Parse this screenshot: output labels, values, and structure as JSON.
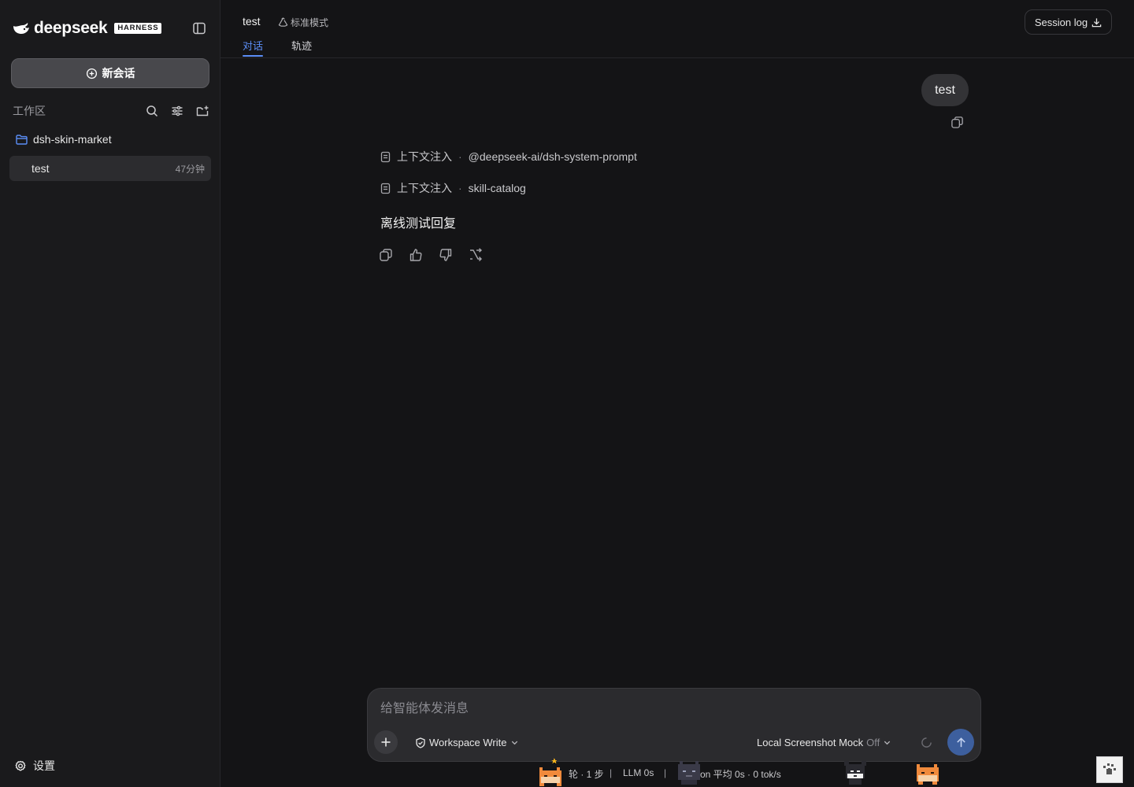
{
  "brand": {
    "name": "deepseek",
    "badge": "HARNESS"
  },
  "sidebar": {
    "new_chat_label": "新会话",
    "workspace_label": "工作区",
    "tools": [
      "search-icon",
      "filter-icon",
      "new-folder-icon"
    ],
    "folder": {
      "name": "dsh-skin-market"
    },
    "sessions": [
      {
        "title": "test",
        "time": "47分钟"
      }
    ],
    "settings_label": "设置"
  },
  "header": {
    "title": "test",
    "mode": "标准模式",
    "tabs": [
      {
        "label": "对话",
        "active": true
      },
      {
        "label": "轨迹",
        "active": false
      }
    ],
    "session_log_label": "Session log"
  },
  "conversation": {
    "user_message": "test",
    "context_items": [
      {
        "label": "上下文注入",
        "target": "@deepseek-ai/dsh-system-prompt"
      },
      {
        "label": "上下文注入",
        "target": "skill-catalog"
      }
    ],
    "reply": "离线测试回复",
    "reply_actions": [
      "copy-icon",
      "thumbs-up-icon",
      "thumbs-down-icon",
      "branch-icon"
    ]
  },
  "composer": {
    "placeholder": "给智能体发消息",
    "permission": "Workspace Write",
    "model": "Local Screenshot Mock",
    "model_state": "Off"
  },
  "status": {
    "segment1": "轮 · 1 步",
    "segment2": "LLM 0s",
    "segment3": "on 平均 0s · 0 tok/s"
  },
  "colors": {
    "accent": "#5b8ef7",
    "background": "#141416",
    "sidebar": "#1a1a1c",
    "mascot": "#f08a3c"
  }
}
